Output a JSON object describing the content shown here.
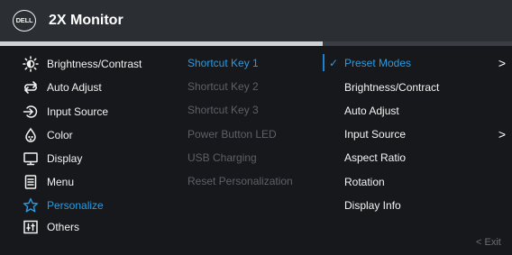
{
  "header": {
    "logo_text": "DELL",
    "title": "2X Monitor"
  },
  "main_menu": [
    {
      "label": "Brightness/Contrast",
      "icon": "brightness-icon",
      "active": false
    },
    {
      "label": "Auto Adjust",
      "icon": "auto-adjust-icon",
      "active": false
    },
    {
      "label": "Input Source",
      "icon": "input-source-icon",
      "active": false
    },
    {
      "label": "Color",
      "icon": "color-icon",
      "active": false
    },
    {
      "label": "Display",
      "icon": "display-icon",
      "active": false
    },
    {
      "label": "Menu",
      "icon": "menu-icon",
      "active": false
    },
    {
      "label": "Personalize",
      "icon": "star-icon",
      "active": true
    },
    {
      "label": "Others",
      "icon": "others-icon",
      "active": false
    }
  ],
  "submenu": [
    {
      "label": "Shortcut Key 1",
      "active": true
    },
    {
      "label": "Shortcut Key 2",
      "active": false
    },
    {
      "label": "Shortcut Key 3",
      "active": false
    },
    {
      "label": "Power Button LED",
      "active": false
    },
    {
      "label": "USB Charging",
      "active": false
    },
    {
      "label": "Reset Personalization",
      "active": false
    }
  ],
  "options": [
    {
      "label": "Preset Modes",
      "selected": true,
      "has_submenu": true
    },
    {
      "label": "Brightness/Contract",
      "selected": false,
      "has_submenu": false
    },
    {
      "label": "Auto Adjust",
      "selected": false,
      "has_submenu": false
    },
    {
      "label": "Input Source",
      "selected": false,
      "has_submenu": true
    },
    {
      "label": "Aspect Ratio",
      "selected": false,
      "has_submenu": false
    },
    {
      "label": "Rotation",
      "selected": false,
      "has_submenu": false
    },
    {
      "label": "Display Info",
      "selected": false,
      "has_submenu": false
    }
  ],
  "exit_label": "< Exit",
  "colors": {
    "accent": "#2a9be2",
    "background": "#16181b",
    "header": "#2b2f34",
    "disabled_text": "#5c6166"
  }
}
